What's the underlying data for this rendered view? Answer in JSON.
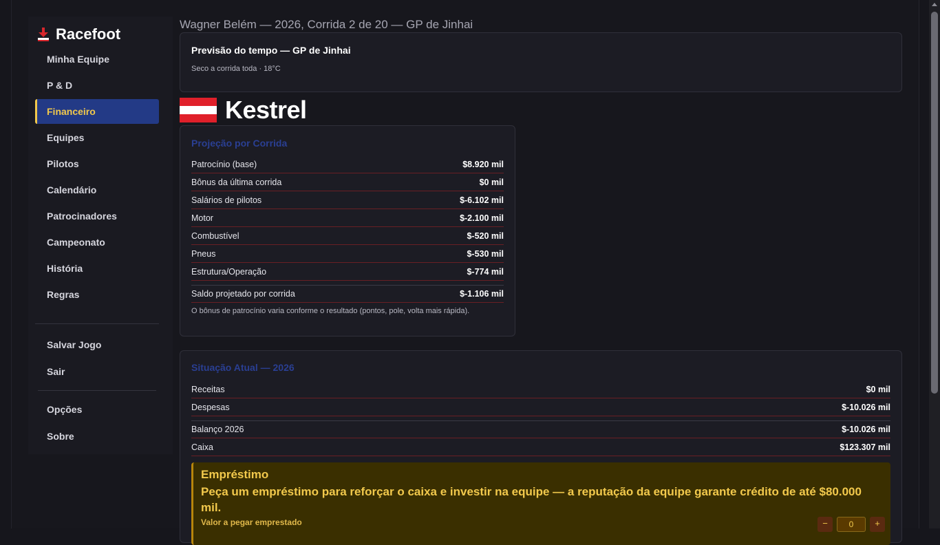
{
  "app": {
    "name": "Racefoot"
  },
  "header": {
    "title": "Wagner Belém — 2026, Corrida 2 de 20 — GP de Jinhai"
  },
  "sidebar": {
    "items": [
      {
        "label": "Minha Equipe"
      },
      {
        "label": "P & D"
      },
      {
        "label": "Financeiro",
        "active": true
      },
      {
        "label": "Equipes"
      },
      {
        "label": "Pilotos"
      },
      {
        "label": "Calendário"
      },
      {
        "label": "Patrocinadores"
      },
      {
        "label": "Campeonato"
      },
      {
        "label": "História"
      },
      {
        "label": "Regras"
      }
    ],
    "actions": [
      {
        "label": "Salvar Jogo"
      },
      {
        "label": "Sair"
      }
    ],
    "extras": [
      {
        "label": "Opções"
      },
      {
        "label": "Sobre"
      }
    ]
  },
  "weather": {
    "title": "Previsão do tempo — GP de Jinhai",
    "subtitle": "Seco a corrida toda · 18°C"
  },
  "team": {
    "name": "Kestrel",
    "flag_colors": [
      "#e0202a",
      "#ffffff",
      "#e0202a"
    ]
  },
  "projection": {
    "title": "Projeção por Corrida",
    "rows": [
      {
        "label": "Patrocínio (base)",
        "value": "$8.920 mil"
      },
      {
        "label": "Bônus da última corrida",
        "value": "$0 mil"
      },
      {
        "label": "Salários de pilotos",
        "value": "$-6.102 mil"
      },
      {
        "label": "Motor",
        "value": "$-2.100 mil"
      },
      {
        "label": "Combustível",
        "value": "$-520 mil"
      },
      {
        "label": "Pneus",
        "value": "$-530 mil"
      },
      {
        "label": "Estrutura/Operação",
        "value": "$-774 mil"
      }
    ],
    "total": {
      "label": "Saldo projetado por corrida",
      "value": "$-1.106 mil"
    },
    "note": "O bônus de patrocínio varia conforme o resultado (pontos, pole, volta mais rápida)."
  },
  "status": {
    "title": "Situação Atual — 2026",
    "rows": [
      {
        "label": "Receitas",
        "value": "$0 mil"
      },
      {
        "label": "Despesas",
        "value": "$-10.026 mil"
      }
    ],
    "totals": [
      {
        "label": "Balanço 2026",
        "value": "$-10.026 mil"
      },
      {
        "label": "Caixa",
        "value": "$123.307 mil"
      }
    ]
  },
  "loan": {
    "title": "Empréstimo",
    "text": "Peça um empréstimo para reforçar o caixa e investir na equipe — a reputação da equipe garante crédito de até $80.000 mil.",
    "amount_label": "Valor a pegar emprestado",
    "amount_value": "0",
    "minus": "−",
    "plus": "+"
  }
}
